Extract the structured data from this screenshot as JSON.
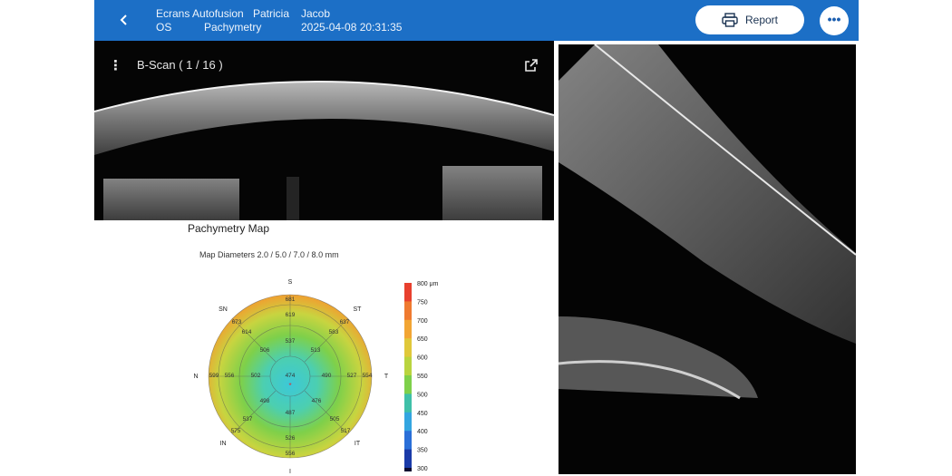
{
  "header": {
    "name_line1": "Ecrans Autofusion",
    "first_name": "Patricia",
    "last_name": "Jacob",
    "eye": "OS",
    "exam": "Pachymetry",
    "datetime": "2025-04-08 20:31:35",
    "report_label": "Report",
    "back_icon": "chevron-left-icon",
    "more_icon": "more-horizontal-icon",
    "report_icon": "printer-icon"
  },
  "bscan": {
    "title": "B-Scan ( 1 / 16 )"
  },
  "map": {
    "title": "Pachymetry Map",
    "subtitle": "Map Diameters 2.0 / 5.0 / 7.0 / 8.0 mm",
    "directions": {
      "S": "S",
      "ST": "ST",
      "T": "T",
      "IT": "IT",
      "I": "I",
      "IN": "IN",
      "N": "N",
      "SN": "SN"
    },
    "center": "474",
    "ring1": {
      "S": "537",
      "ST": "513",
      "T": "490",
      "IT": "476",
      "I": "487",
      "IN": "498",
      "N": "502",
      "SN": "506"
    },
    "ring2": {
      "S": "619",
      "ST": "583",
      "T": "527",
      "IT": "505",
      "I": "526",
      "IN": "537",
      "N": "556",
      "SN": "614"
    },
    "ring3": {
      "S": "681",
      "ST": "637",
      "T": "554",
      "IT": "517",
      "I": "556",
      "IN": "575",
      "N": "599",
      "SN": "673"
    },
    "scale": {
      "ticks": [
        "800 μm",
        "750",
        "700",
        "650",
        "600",
        "550",
        "500",
        "450",
        "400",
        "350",
        "300"
      ],
      "colors": [
        "#e8402e",
        "#ef7a30",
        "#f2a533",
        "#e0c83a",
        "#b9d43f",
        "#7ed04a",
        "#3fc0a8",
        "#33a5e0",
        "#2a6fd8",
        "#1a3aa8",
        "#0b0b30"
      ]
    }
  }
}
